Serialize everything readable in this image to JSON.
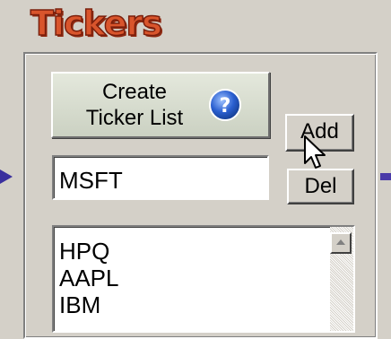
{
  "section": {
    "title": "Tickers"
  },
  "toolbar": {
    "create_label_line1": "Create",
    "create_label_line2": "Ticker List",
    "help_icon": "question-circle-icon",
    "add_label": "Add",
    "del_label": "Del"
  },
  "ticker_input": {
    "value": "MSFT"
  },
  "ticker_list": {
    "items": [
      "HPQ",
      "AAPL",
      "IBM"
    ]
  },
  "colors": {
    "title": "#d9552c",
    "help_icon": "#2a5fd0",
    "arrow": "#3a2f9e"
  }
}
